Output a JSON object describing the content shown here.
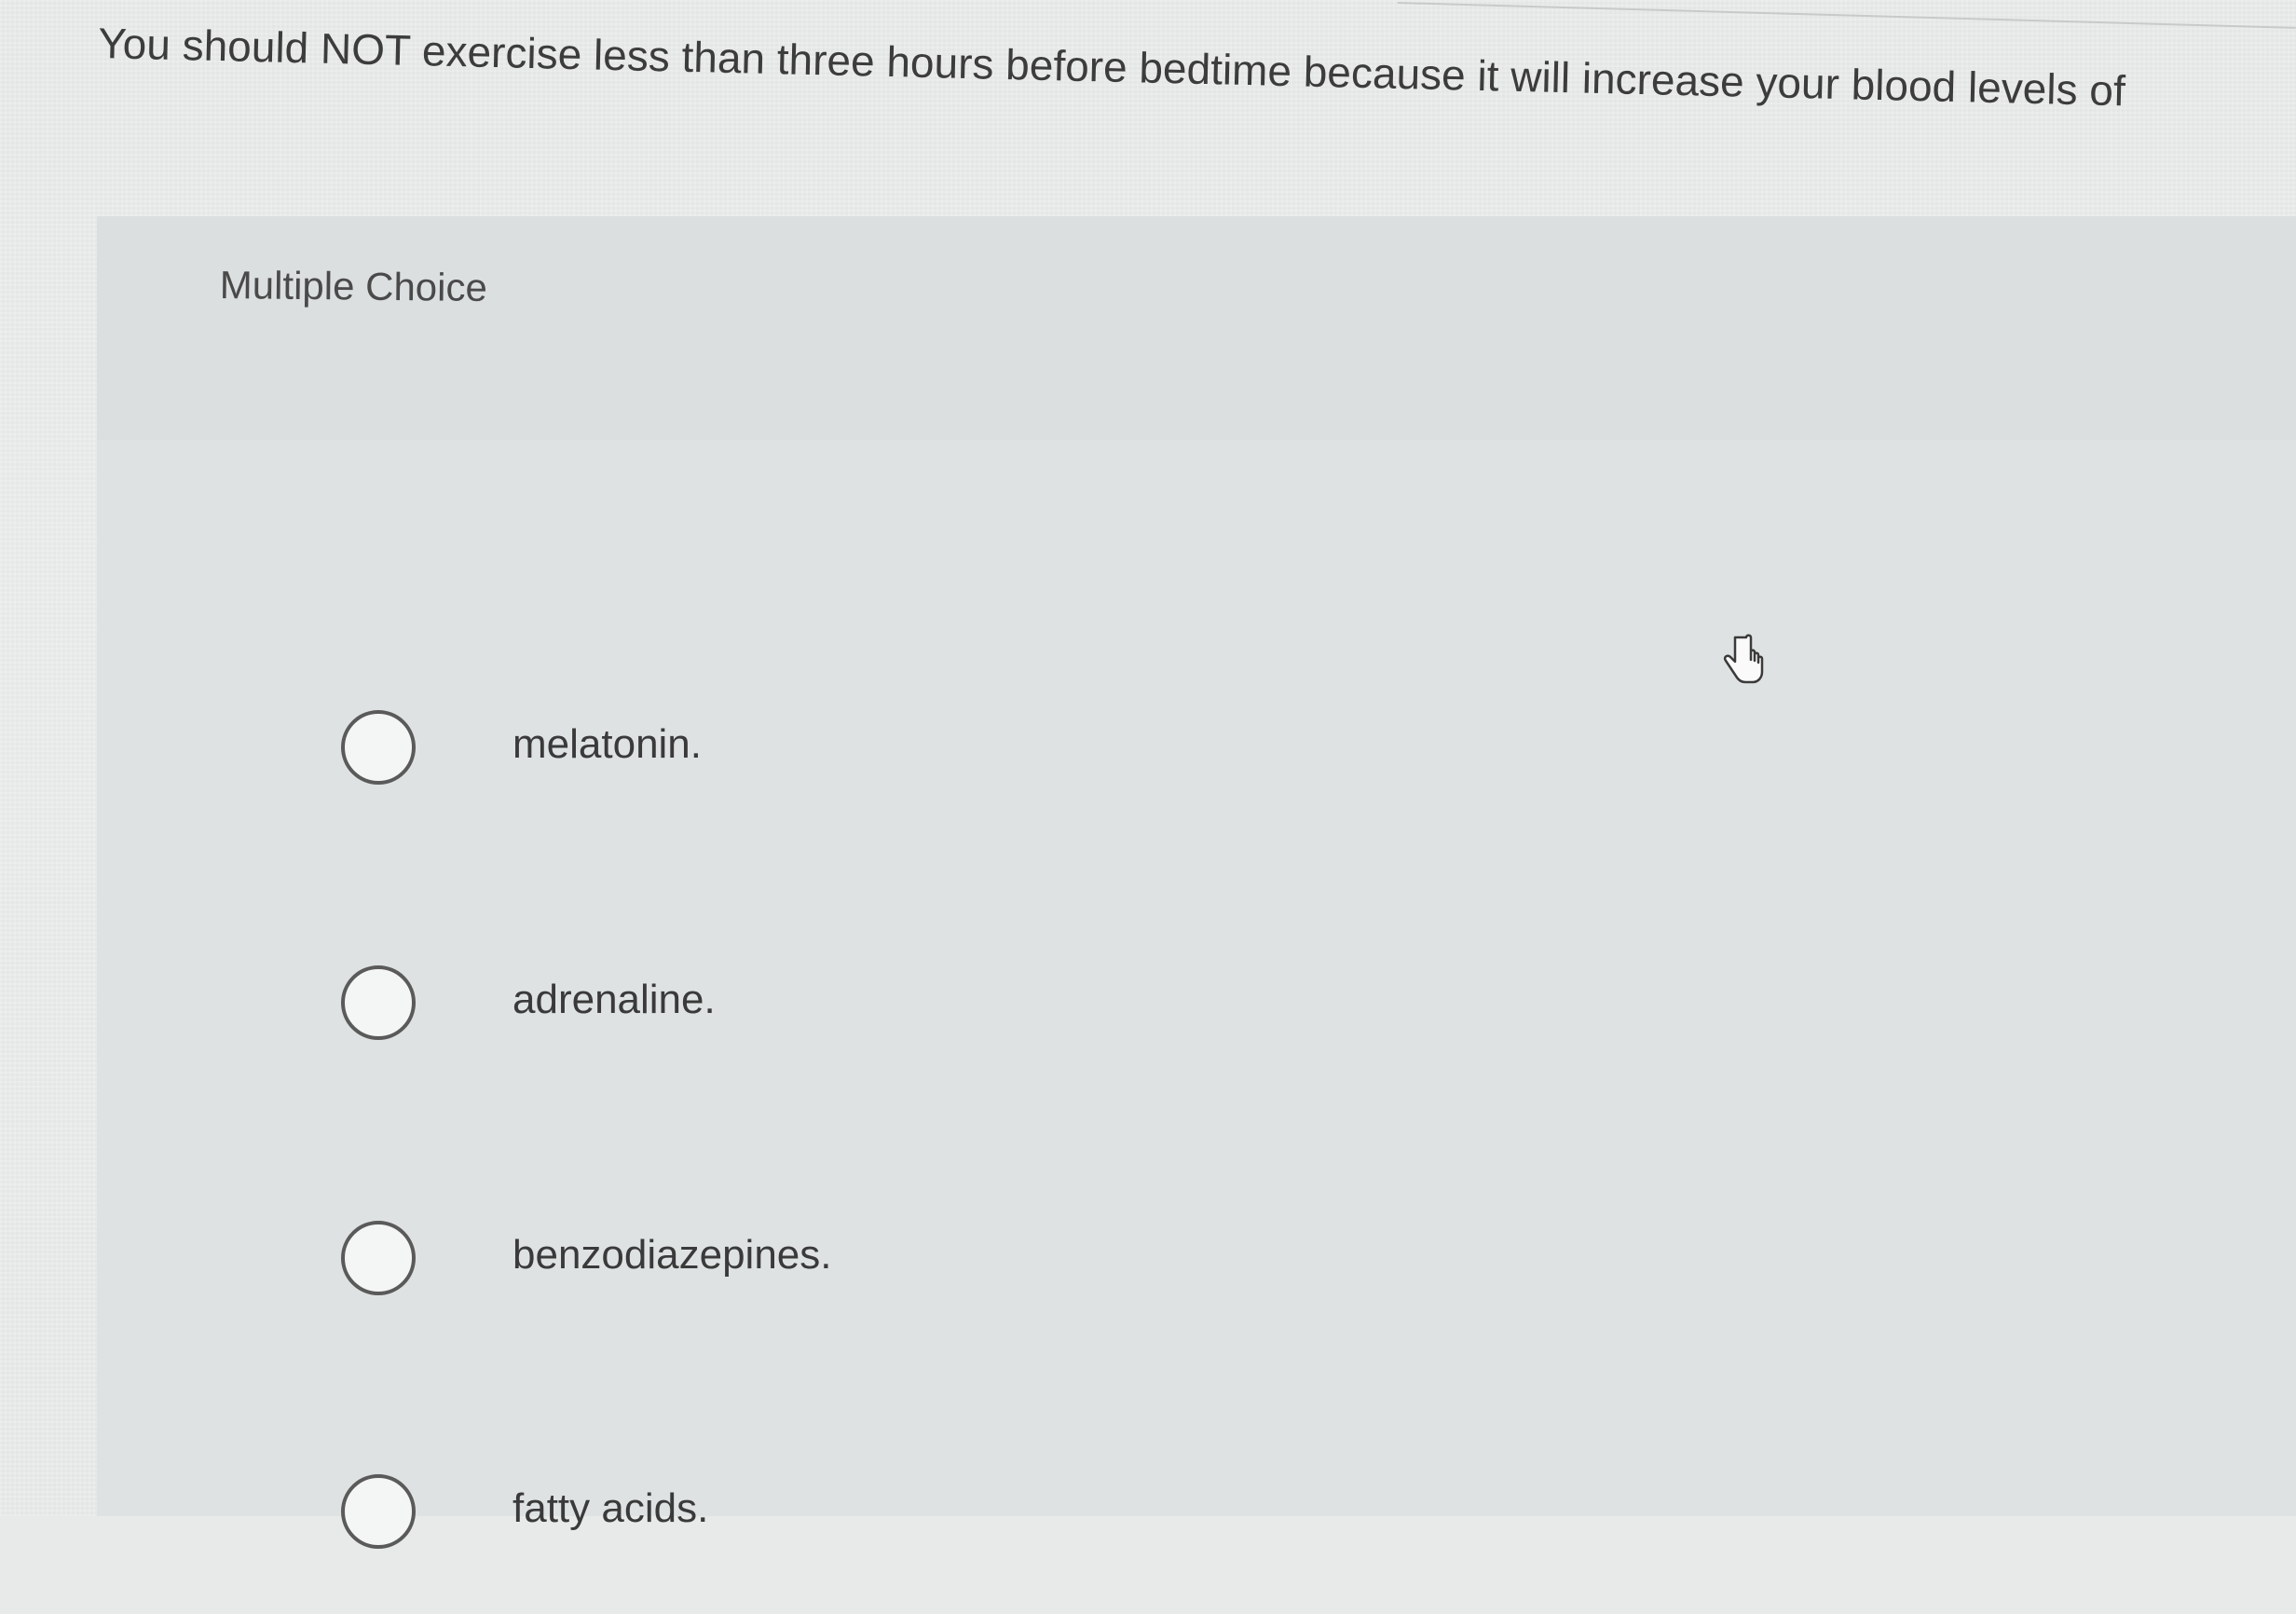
{
  "question": {
    "text": "You should NOT exercise less than three hours before bedtime because it will increase your blood levels of"
  },
  "panel": {
    "type_label": "Multiple Choice"
  },
  "options": [
    {
      "label": "melatonin.",
      "selected": false
    },
    {
      "label": "adrenaline.",
      "selected": false
    },
    {
      "label": "benzodiazepines.",
      "selected": false
    },
    {
      "label": "fatty acids.",
      "selected": false
    }
  ],
  "cursor": {
    "icon": "hand-pointer-icon"
  }
}
